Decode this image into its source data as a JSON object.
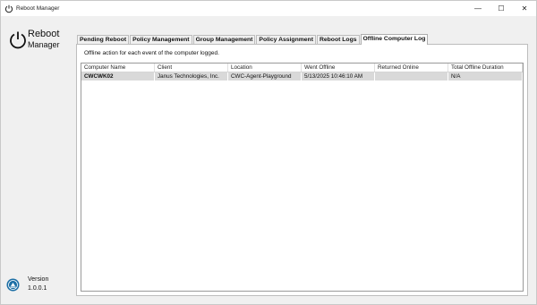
{
  "window": {
    "title": "Reboot Manager"
  },
  "controls": {
    "minimize": "—",
    "maximize": "☐",
    "close": "✕"
  },
  "brand": {
    "line1": "Reboot",
    "line2": "Manager"
  },
  "version": {
    "label": "Version",
    "number": "1.0.0.1"
  },
  "tabs": [
    {
      "label": "Pending Reboot"
    },
    {
      "label": "Policy Management"
    },
    {
      "label": "Group Management"
    },
    {
      "label": "Policy Assignment"
    },
    {
      "label": "Reboot Logs"
    },
    {
      "label": "Offline Computer Log"
    }
  ],
  "active_tab": "Offline Computer Log",
  "pane": {
    "description": "Offline action for each event of the computer logged."
  },
  "table": {
    "columns": [
      "Computer Name",
      "Client",
      "Location",
      "Went Offline",
      "Returned Online",
      "Total Offline Duration"
    ],
    "rows": [
      [
        "CWCWK02",
        "Janus Technologies, Inc.",
        "CWC-Agent-Playground",
        "5/13/2025 10:46:10 AM",
        "",
        "N/A"
      ]
    ]
  }
}
